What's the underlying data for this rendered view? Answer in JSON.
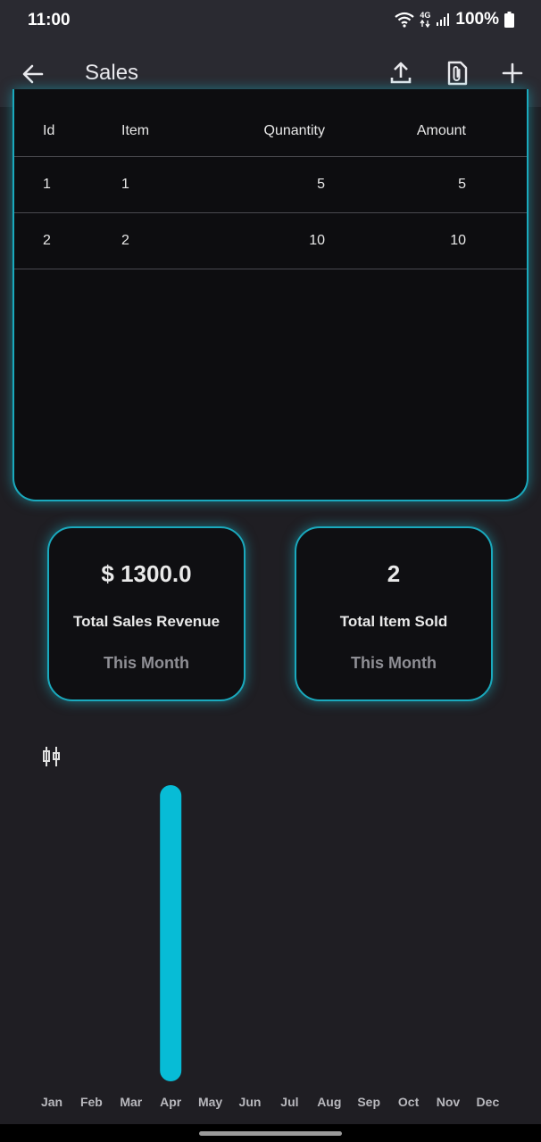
{
  "status_bar": {
    "time": "11:00",
    "network": "4G",
    "battery": "100%",
    "icons": [
      "wifi-icon",
      "signal-icon",
      "battery-icon"
    ]
  },
  "app_bar": {
    "title": "Sales",
    "icons": [
      "back-arrow-icon",
      "upload-icon",
      "attachment-icon",
      "add-icon"
    ]
  },
  "table": {
    "columns": [
      "Id",
      "Item",
      "Qunantity",
      "Amount"
    ],
    "rows": [
      {
        "id": "1",
        "item": "1",
        "quantity": "5",
        "amount": "5"
      },
      {
        "id": "2",
        "item": "2",
        "quantity": "10",
        "amount": "10"
      }
    ]
  },
  "stats": {
    "revenue": {
      "value": "$ 1300.0",
      "label": "Total Sales Revenue",
      "period": "This Month"
    },
    "items": {
      "value": "2",
      "label": "Total Item Sold",
      "period": "This Month"
    }
  },
  "colors": {
    "accent": "#1aa9bd",
    "bar": "#07bcd6",
    "background": "#1f1e23",
    "card": "#0d0d10"
  },
  "chart_data": {
    "type": "bar",
    "categories": [
      "Jan",
      "Feb",
      "Mar",
      "Apr",
      "May",
      "Jun",
      "Jul",
      "Aug",
      "Sep",
      "Oct",
      "Nov",
      "Dec"
    ],
    "values": [
      0,
      0,
      0,
      1300,
      0,
      0,
      0,
      0,
      0,
      0,
      0,
      0
    ],
    "title": "",
    "xlabel": "",
    "ylabel": "",
    "ylim": [
      0,
      1300
    ],
    "grid": false
  }
}
